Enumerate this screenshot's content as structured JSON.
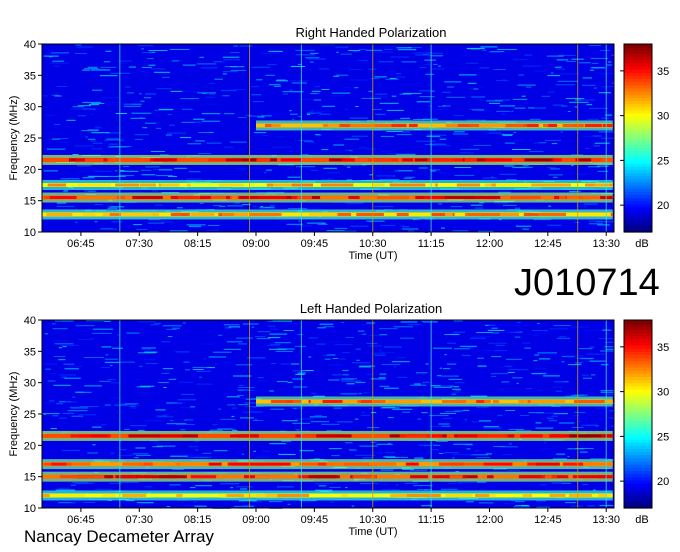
{
  "observation_id": "J010714",
  "footer_label": "Nancay Decameter Array",
  "chart_data": [
    {
      "type": "heatmap",
      "title": "Right Handed Polarization",
      "xlabel": "Time (UT)",
      "ylabel": "Frequency (MHz)",
      "x_ticks": [
        "06:45",
        "07:30",
        "08:15",
        "09:00",
        "09:45",
        "10:30",
        "11:15",
        "12:00",
        "12:45",
        "13:30"
      ],
      "y_ticks": [
        "10",
        "15",
        "20",
        "25",
        "30",
        "35",
        "40"
      ],
      "ylim": [
        10,
        40
      ],
      "colorbar": {
        "label": "dB",
        "ticks": [
          "20",
          "25",
          "30",
          "35"
        ],
        "range": [
          17,
          38
        ]
      },
      "bands": [
        {
          "freq": 27.0,
          "start": "09:00",
          "end": "13:35",
          "level": 35
        },
        {
          "freq": 21.5,
          "start": "06:15",
          "end": "13:35",
          "level": 38
        },
        {
          "freq": 17.5,
          "start": "06:15",
          "end": "13:35",
          "level": 33
        },
        {
          "freq": 15.5,
          "start": "06:15",
          "end": "13:35",
          "level": 37
        },
        {
          "freq": 12.8,
          "start": "06:15",
          "end": "13:35",
          "level": 34
        }
      ]
    },
    {
      "type": "heatmap",
      "title": "Left Handed Polarization",
      "xlabel": "Time (UT)",
      "ylabel": "Frequency (MHz)",
      "x_ticks": [
        "06:45",
        "07:30",
        "08:15",
        "09:00",
        "09:45",
        "10:30",
        "11:15",
        "12:00",
        "12:45",
        "13:30"
      ],
      "y_ticks": [
        "10",
        "15",
        "20",
        "25",
        "30",
        "35",
        "40"
      ],
      "ylim": [
        10,
        40
      ],
      "colorbar": {
        "label": "dB",
        "ticks": [
          "20",
          "25",
          "30",
          "35"
        ],
        "range": [
          17,
          38
        ]
      },
      "bands": [
        {
          "freq": 27.0,
          "start": "09:00",
          "end": "13:35",
          "level": 35
        },
        {
          "freq": 21.5,
          "start": "06:15",
          "end": "13:35",
          "level": 38
        },
        {
          "freq": 17.0,
          "start": "06:15",
          "end": "13:35",
          "level": 36
        },
        {
          "freq": 15.0,
          "start": "06:15",
          "end": "13:35",
          "level": 37
        },
        {
          "freq": 12.0,
          "start": "06:15",
          "end": "13:35",
          "level": 33
        }
      ]
    }
  ]
}
